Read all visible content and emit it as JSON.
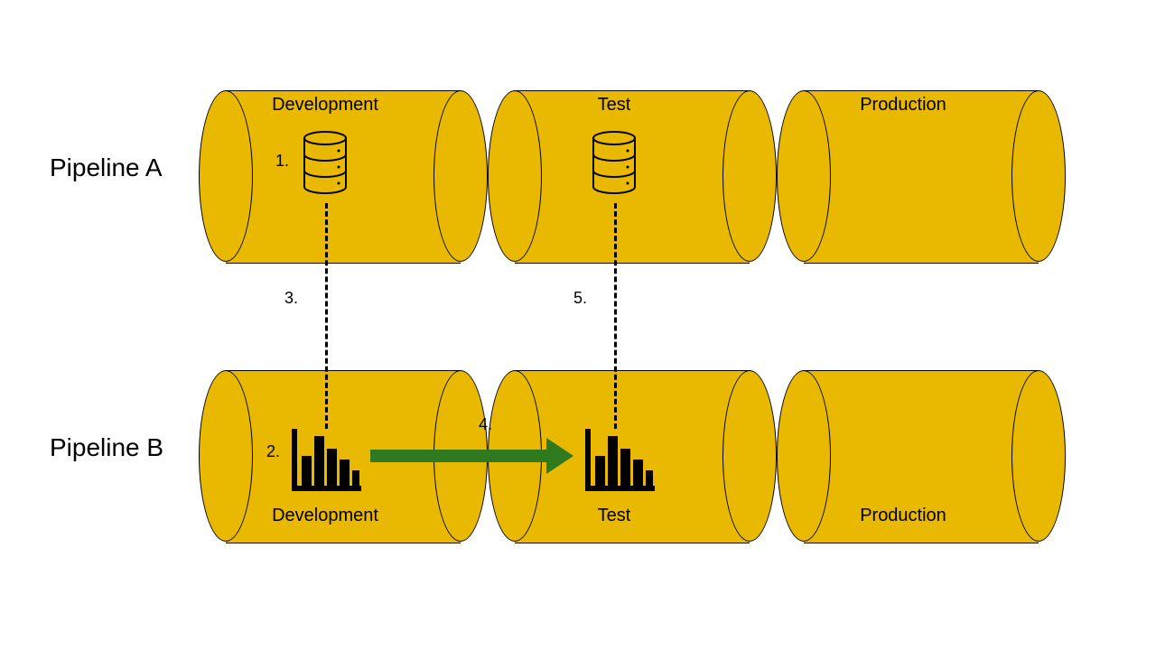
{
  "colors": {
    "cylinder_fill": "#e8b900",
    "cylinder_stroke": "#000000",
    "arrow": "#2f7a1f"
  },
  "pipelines": {
    "a": {
      "label": "Pipeline A"
    },
    "b": {
      "label": "Pipeline B"
    }
  },
  "stages": {
    "dev": "Development",
    "test": "Test",
    "prod": "Production"
  },
  "steps": {
    "s1": "1.",
    "s2": "2.",
    "s3": "3.",
    "s4": "4.",
    "s5": "5."
  }
}
